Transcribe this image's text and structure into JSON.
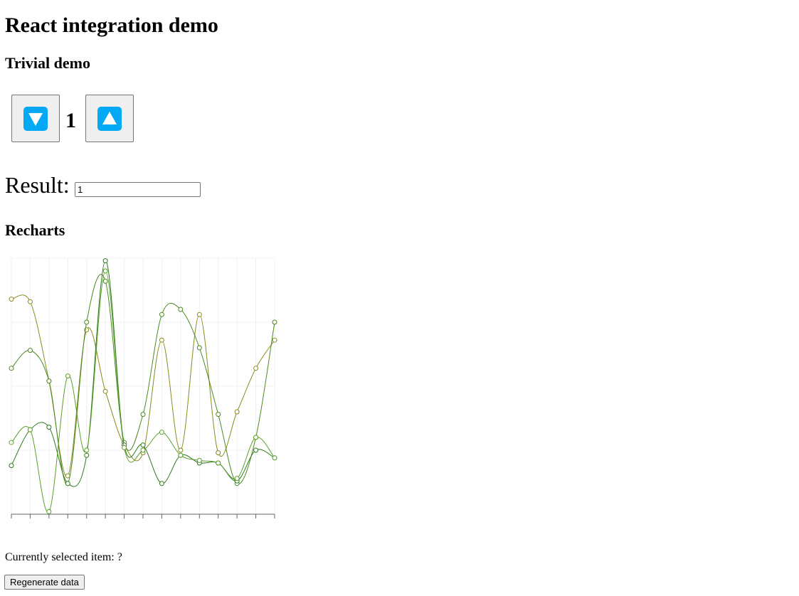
{
  "page": {
    "title": "React integration demo"
  },
  "trivial_demo": {
    "heading": "Trivial demo",
    "decrement_icon": "arrow-down-icon",
    "increment_icon": "arrow-up-icon",
    "icon_color": "#03a9f4",
    "count": "1"
  },
  "result": {
    "label": "Result:",
    "value": "1"
  },
  "recharts": {
    "heading": "Recharts",
    "selected_label": "Currently selected item: ?",
    "regenerate_label": "Regenerate data"
  },
  "chart_data": {
    "type": "line",
    "x": [
      0,
      1,
      2,
      3,
      4,
      5,
      6,
      7,
      8,
      9,
      10,
      11,
      12,
      13,
      14
    ],
    "ylim": [
      0,
      100
    ],
    "grid": true,
    "legend": "none",
    "series": [
      {
        "color": "#8a8a1e",
        "values": [
          84,
          83,
          52,
          15,
          72,
          48,
          27,
          24,
          68,
          25,
          78,
          24,
          40,
          57,
          68
        ]
      },
      {
        "color": "#4a8a1e",
        "values": [
          57,
          64,
          52,
          12,
          75,
          91,
          28,
          39,
          78,
          80,
          65,
          39,
          12,
          30,
          75
        ]
      },
      {
        "color": "#2e7a1e",
        "values": [
          19,
          33,
          34,
          12,
          23,
          99,
          27,
          27,
          12,
          23,
          20,
          20,
          13,
          25,
          22
        ]
      },
      {
        "color": "#5aa02a",
        "values": [
          28,
          33,
          1,
          54,
          25,
          95,
          26,
          25,
          32,
          23,
          21,
          20,
          14,
          30,
          22
        ]
      }
    ]
  }
}
